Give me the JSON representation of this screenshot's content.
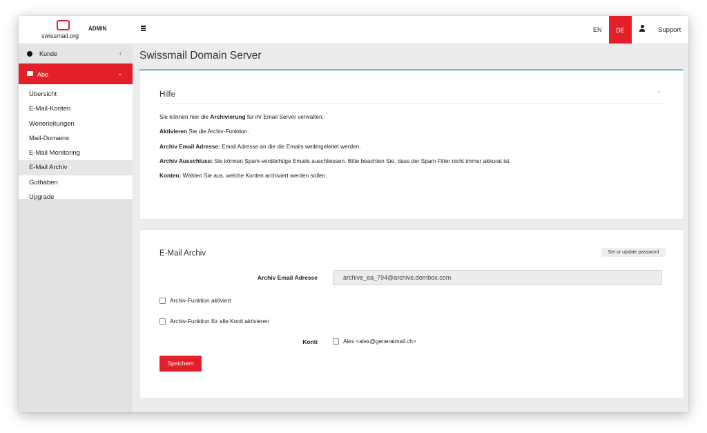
{
  "brand": {
    "site": "swissmail.org",
    "role": "ADMIN",
    "accent": "#e3202a",
    "highlight": "#5bc5d9"
  },
  "sidebar": {
    "kunde": {
      "label": "Kunde",
      "chevron": "‹"
    },
    "abo": {
      "label": "Abo",
      "chevron": "⌄"
    },
    "items": [
      {
        "label": "Übersicht"
      },
      {
        "label": "E-Mail-Konten"
      },
      {
        "label": "Weiterleitungen"
      },
      {
        "label": "Mail-Domains"
      },
      {
        "label": "E-Mail Monitoring"
      },
      {
        "label": "E-Mail Archiv",
        "active": true
      },
      {
        "label": "Guthaben"
      },
      {
        "label": "Upgrade"
      }
    ]
  },
  "topbar": {
    "lang_en": "EN",
    "lang_de": "DE",
    "lang_active": "DE",
    "support": "Support"
  },
  "main": {
    "title": "Swissmail Domain Server"
  },
  "help": {
    "title": "Hilfe",
    "line1": {
      "pre": "Sie können hier die ",
      "bold": "Archivierung",
      "post": " für ihr Email Server verwalten."
    },
    "line2": {
      "bold": "Aktivieren",
      "post": " Sie die Archiv-Funktion."
    },
    "line3": {
      "bold": "Archiv Email Adresse:",
      "post": " Email Adresse an die die Emails weitergeleitet werden."
    },
    "line4": {
      "bold": "Archiv Ausschluss:",
      "post": " Sie können Spam-verdächtige Emails auschliessen. Bitte beachten Sie, dass der Spam Filter nicht immer akkurat ist."
    },
    "line5": {
      "bold": "Konten:",
      "post": " Wählen Sie aus, welche Konten archiviert werden sollen."
    }
  },
  "archive": {
    "title": "E-Mail Archiv",
    "password_button": "Set or update password",
    "address_label": "Archiv Email Adresse",
    "address_value": "archive_ea_794@archive.dombox.com",
    "checkbox_activate": {
      "label": "Archiv-Funktion aktiviert",
      "checked": false
    },
    "checkbox_all": {
      "label": "Archiv-Funktion für alle Konti aktivieren",
      "checked": false
    },
    "konti_label": "Konti",
    "konti_account": {
      "label": "Alex <alex@generalmail.ch>",
      "checked": false
    },
    "save_button": "Speichern"
  }
}
